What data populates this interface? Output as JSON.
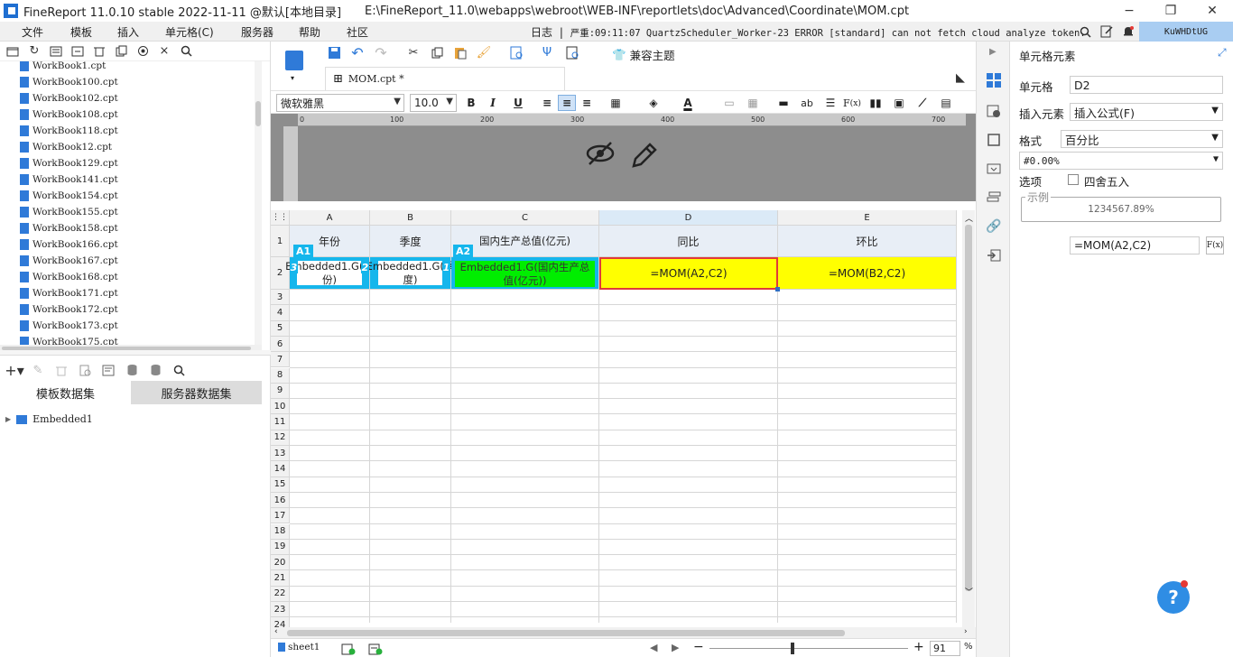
{
  "titlebar": {
    "title": "FineReport 11.0.10 stable 2022-11-11 @默认[本地目录]",
    "path": "E:\\FineReport_11.0\\webapps\\webroot\\WEB-INF\\reportlets\\doc\\Advanced\\Coordinate\\MOM.cpt",
    "minimize": "−",
    "restore": "❐",
    "close": "✕"
  },
  "menu": {
    "items": [
      "文件",
      "模板",
      "插入",
      "单元格(C)",
      "服务器",
      "帮助",
      "社区"
    ],
    "log_label": "日志",
    "log_sep": "|",
    "log_text": "严重:09:11:07 QuartzScheduler_Worker-23 ERROR [standard] can not fetch cloud analyze token.",
    "user": "KuWHDtUG"
  },
  "file_list": [
    "WorkBook1.cpt",
    "WorkBook100.cpt",
    "WorkBook102.cpt",
    "WorkBook108.cpt",
    "WorkBook118.cpt",
    "WorkBook12.cpt",
    "WorkBook129.cpt",
    "WorkBook141.cpt",
    "WorkBook154.cpt",
    "WorkBook155.cpt",
    "WorkBook158.cpt",
    "WorkBook166.cpt",
    "WorkBook167.cpt",
    "WorkBook168.cpt",
    "WorkBook171.cpt",
    "WorkBook172.cpt",
    "WorkBook173.cpt",
    "WorkBook175.cpt"
  ],
  "datasets": {
    "tab_template": "模板数据集",
    "tab_server": "服务器数据集",
    "tree": [
      "Embedded1"
    ]
  },
  "editor": {
    "file_tab": "MOM.cpt *",
    "font_name": "微软雅黑",
    "font_size": "10.0",
    "compat_theme": "兼容主题",
    "ruler_ticks": [
      "0",
      "100",
      "200",
      "300",
      "400",
      "500",
      "600",
      "700"
    ]
  },
  "grid": {
    "columns": [
      "A",
      "B",
      "C",
      "D",
      "E"
    ],
    "rows": [
      "1",
      "2",
      "3",
      "4",
      "5",
      "6",
      "7",
      "8",
      "9",
      "10",
      "11",
      "12",
      "13",
      "14",
      "15",
      "16",
      "17",
      "18",
      "19",
      "20",
      "21",
      "22",
      "23",
      "24"
    ],
    "header_row": [
      "年份",
      "季度",
      "国内生产总值(亿元)",
      "同比",
      "环比"
    ],
    "data_row": [
      "Embedded1.G(年份)",
      "Embedded1.G(季度)",
      "Embedded1.G(国内生产总值(亿元))",
      "=MOM(A2,C2)",
      "=MOM(B2,C2)"
    ],
    "badges": [
      "A1",
      "A2"
    ],
    "side_badges": [
      "3",
      "2",
      "1"
    ]
  },
  "sheet": {
    "name": "sheet1",
    "zoom_minus": "−",
    "zoom_plus": "+",
    "zoom": "91",
    "zoom_unit": "%"
  },
  "right_panel": {
    "title": "单元格元素",
    "cell_label": "单元格",
    "cell_value": "D2",
    "insert_label": "插入元素",
    "insert_value": "插入公式(F)",
    "format_label": "格式",
    "format_value": "百分比",
    "format_pattern": "#0.00%",
    "option_label": "选项",
    "round_label": "四舍五入",
    "example_label": "示例",
    "example_value": "1234567.89%",
    "formula": "=MOM(A2,C2)",
    "fx": "F(x)"
  },
  "help": "?",
  "colors": {
    "accent": "#1f6fd1",
    "cyan": "#15b6ec",
    "yellow": "#ffff00",
    "green": "#00ee00",
    "selected_border": "#e03a3a"
  }
}
